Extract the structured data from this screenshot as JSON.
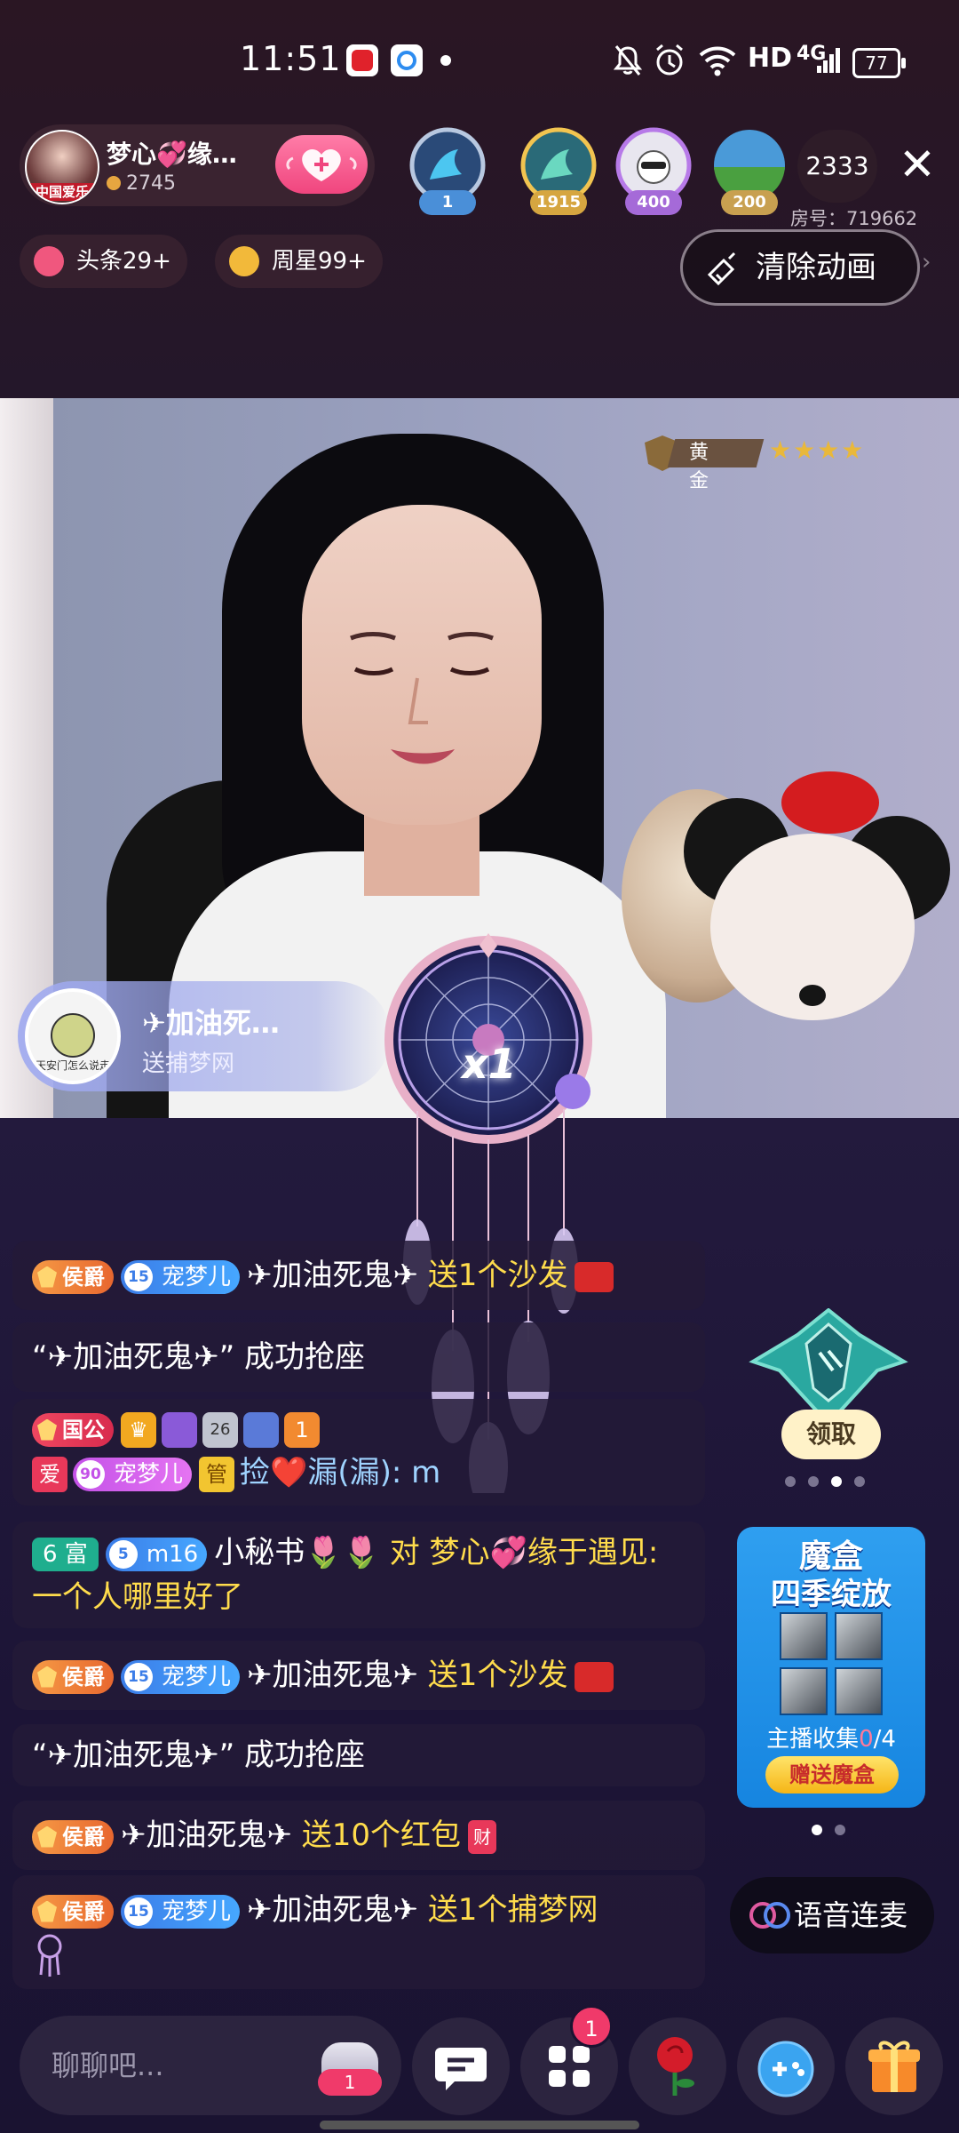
{
  "status_bar": {
    "time": "11:51",
    "network": "HD",
    "signal": "4G",
    "battery": "77"
  },
  "anchor": {
    "name": "梦心💞缘…",
    "fans": "2745",
    "avatar_tag": "中国爱乐"
  },
  "viewers": [
    {
      "badge": "1",
      "color": "#4a8fd8"
    },
    {
      "badge": "1915",
      "color": "#4db8a0"
    },
    {
      "badge": "400",
      "color": "#a56ad8"
    },
    {
      "badge": "200",
      "color": "#c8a050"
    }
  ],
  "viewer_count": "2333",
  "room_id": "房号：719662",
  "chips": [
    {
      "label": "头条29+",
      "color": "#f0577e"
    },
    {
      "label": "周星99+",
      "color": "#f2b93a"
    }
  ],
  "clear_animation": "清除动画",
  "rank": {
    "label": "黄金",
    "stars": "★★★★"
  },
  "gift_banner": {
    "user": "✈加油死…",
    "desc": "送捕梦网",
    "count": "x1",
    "avatar_caption": "天安门怎么说走"
  },
  "chat": {
    "rows": [
      {
        "title": "侯爵",
        "fan_level": "15",
        "fan_name": "宠梦儿",
        "user": "✈加油死鬼✈",
        "text": "送1个沙发"
      },
      {
        "text": "“✈加油死鬼✈” 成功抢座"
      },
      {
        "title": "国公",
        "icon_level_1": "26",
        "icon_level_2": "1",
        "tag_love": "爱",
        "fan_level": "90",
        "fan_name": "宠梦儿",
        "tag_admin": "管",
        "user": "捡❤️漏(漏):",
        "text": "m"
      },
      {
        "rich": "6 富",
        "fan_level": "5",
        "fan_name": "m16",
        "user": "小秘书🌷🌷",
        "text": "对 梦心💞缘于遇见: 一个人哪里好了"
      },
      {
        "title": "侯爵",
        "fan_level": "15",
        "fan_name": "宠梦儿",
        "user": "✈加油死鬼✈",
        "text": "送1个沙发"
      },
      {
        "text": "“✈加油死鬼✈” 成功抢座"
      },
      {
        "title": "侯爵",
        "user": "✈加油死鬼✈",
        "text": "送10个红包",
        "icon_text": "财"
      },
      {
        "title": "侯爵",
        "fan_level": "15",
        "fan_name": "宠梦儿",
        "user": "✈加油死鬼✈",
        "text": "送1个捕梦网"
      }
    ]
  },
  "claim_label": "领取",
  "magic_box": {
    "title": "魔盒",
    "subtitle": "四季绽放",
    "collect_prefix": "主播收集",
    "collect_have": "0",
    "collect_total": "/4",
    "button": "赠送魔盒"
  },
  "voice_link": "语音连麦",
  "bottom_bar": {
    "chat_placeholder": "聊聊吧...",
    "cloud_count": "1",
    "apps_notif": "1"
  }
}
